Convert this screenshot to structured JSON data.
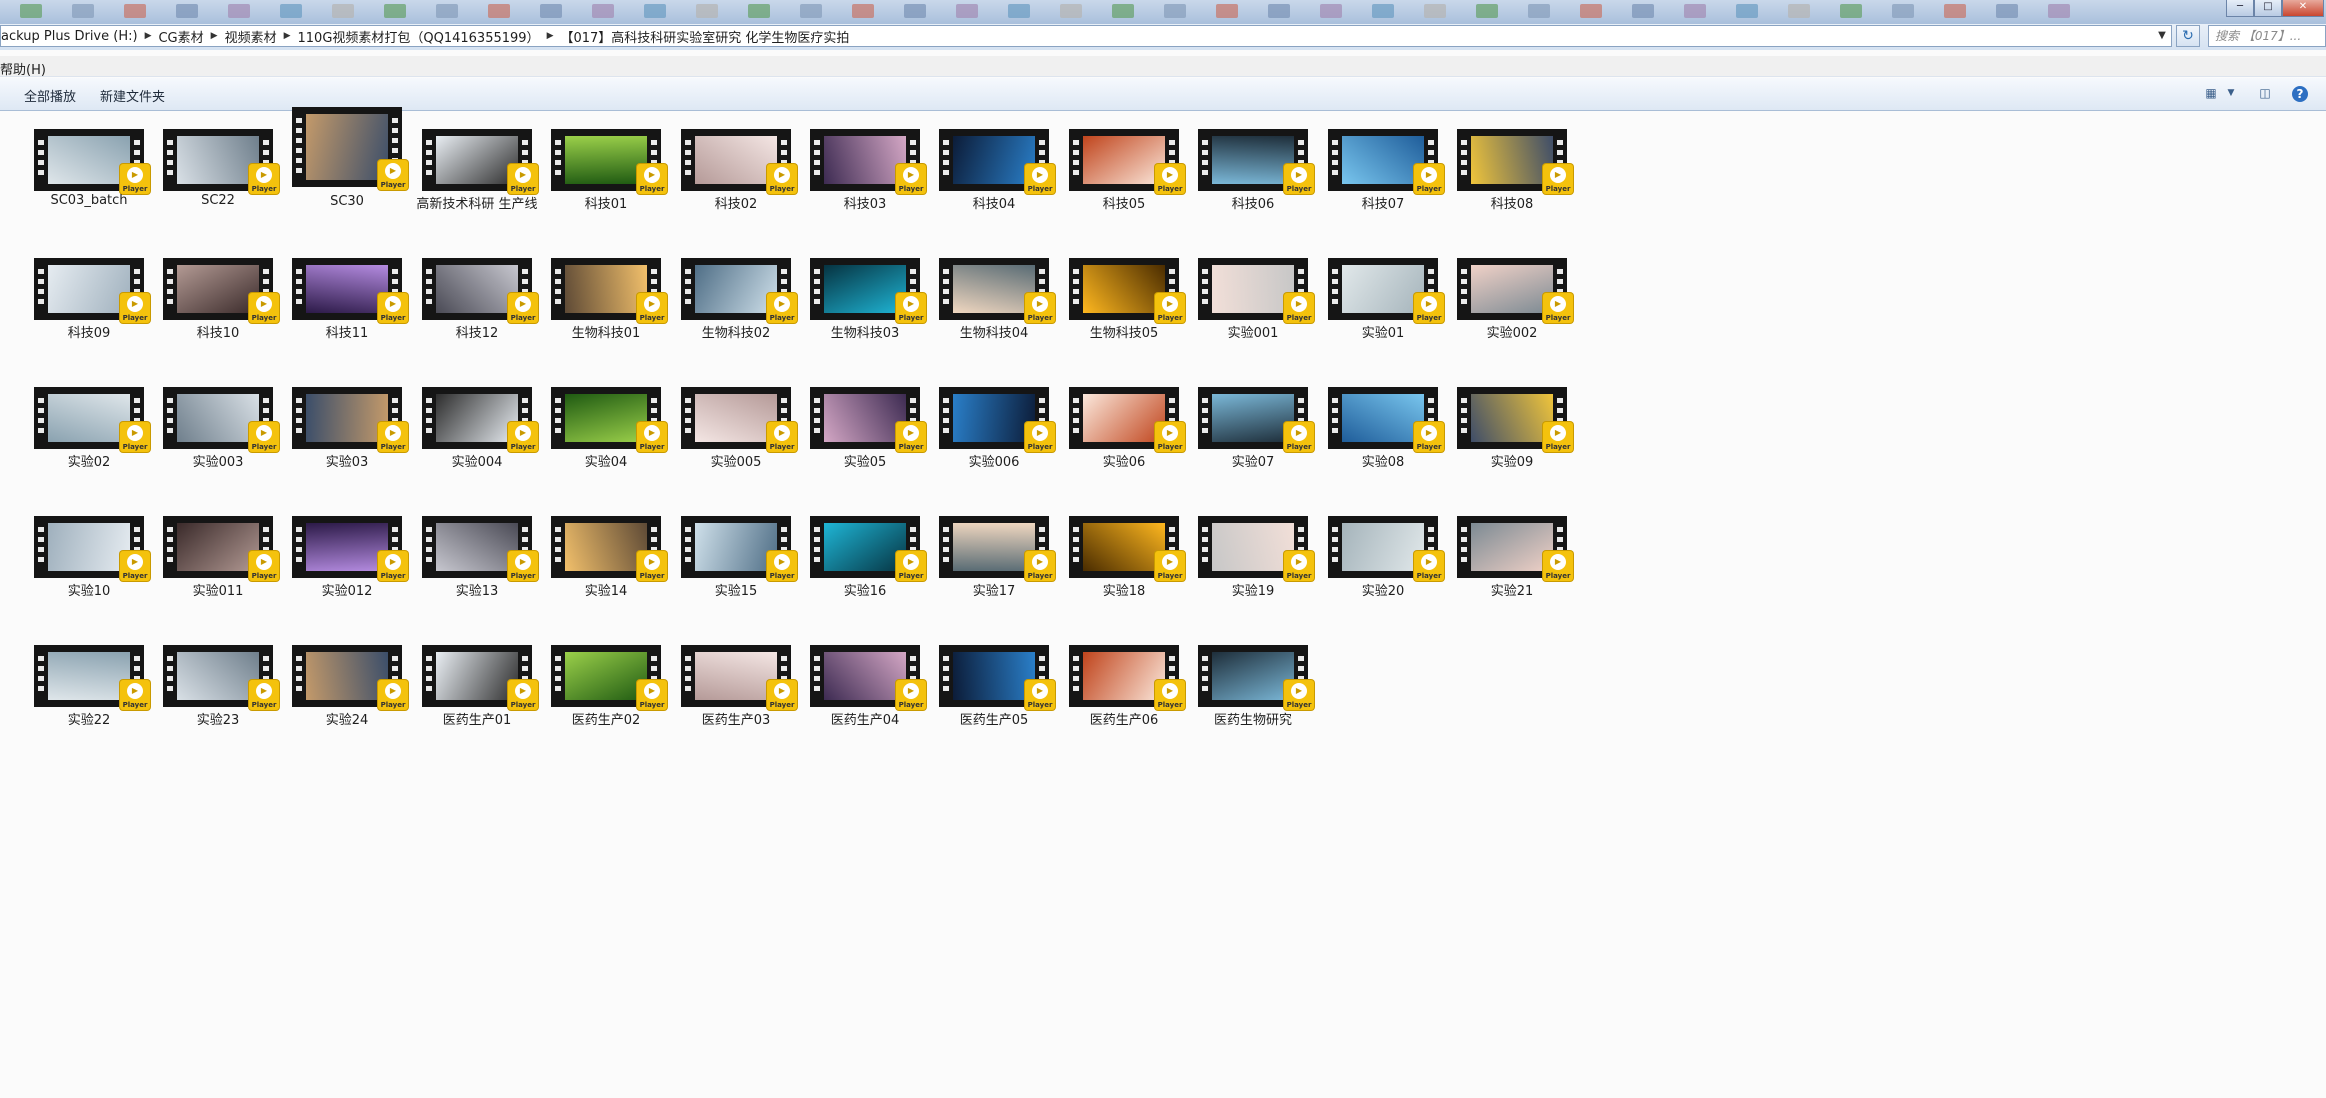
{
  "window": {
    "minimize": "─",
    "maximize": "□",
    "close": "✕"
  },
  "address": {
    "crumbs": [
      "ackup Plus Drive (H:)",
      "CG素材",
      "视频素材",
      "110G视频素材打包（QQ1416355199）",
      "【017】高科技科研实验室研究 化学生物医疗实拍"
    ]
  },
  "search": {
    "placeholder": "搜索 【017】..."
  },
  "menu": {
    "help": "帮助(H)"
  },
  "toolbar": {
    "play_all": "全部播放",
    "new_folder": "新建文件夹"
  },
  "badge_text": "Player",
  "colors": {
    "badge": "#f4c20d",
    "toolbar_bg": "#dee8f4"
  },
  "files": [
    "SC03_batch",
    "SC22",
    "SC30",
    "高新技术科研 生产线",
    "科技01",
    "科技02",
    "科技03",
    "科技04",
    "科技05",
    "科技06",
    "科技07",
    "科技08",
    "科技09",
    "科技10",
    "科技11",
    "科技12",
    "生物科技01",
    "生物科技02",
    "生物科技03",
    "生物科技04",
    "生物科技05",
    "实验001",
    "实验01",
    "实验002",
    "实验02",
    "实验003",
    "实验03",
    "实验004",
    "实验04",
    "实验005",
    "实验05",
    "实验006",
    "实验06",
    "实验07",
    "实验08",
    "实验09",
    "实验10",
    "实验011",
    "实验012",
    "实验13",
    "实验14",
    "实验15",
    "实验16",
    "实验17",
    "实验18",
    "实验19",
    "实验20",
    "实验21",
    "实验22",
    "实验23",
    "实验24",
    "医药生产01",
    "医药生产02",
    "医药生产03",
    "医药生产04",
    "医药生产05",
    "医药生产06",
    "医药生物研究"
  ]
}
